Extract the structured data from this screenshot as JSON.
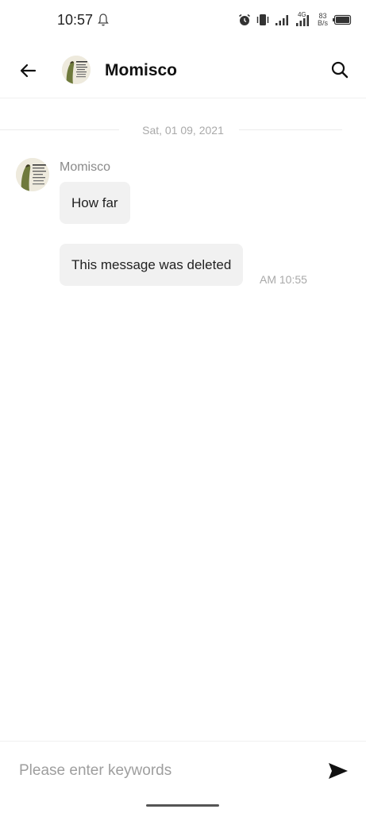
{
  "status_bar": {
    "time": "10:57",
    "network_label": "4G",
    "speed_value": "83",
    "speed_unit": "B/s"
  },
  "header": {
    "title": "Momisco"
  },
  "chat": {
    "date_separator": "Sat, 01 09, 2021",
    "sender_name": "Momisco",
    "messages": [
      {
        "text": "How far"
      },
      {
        "text": "This message was deleted",
        "time": "AM 10:55"
      }
    ]
  },
  "input": {
    "placeholder": "Please enter keywords",
    "value": ""
  },
  "icons": {
    "back": "arrow-left-icon",
    "search": "search-icon",
    "send": "send-icon",
    "bell": "bell-icon",
    "alarm": "alarm-icon",
    "vibrate": "vibrate-icon",
    "battery": "battery-icon"
  }
}
